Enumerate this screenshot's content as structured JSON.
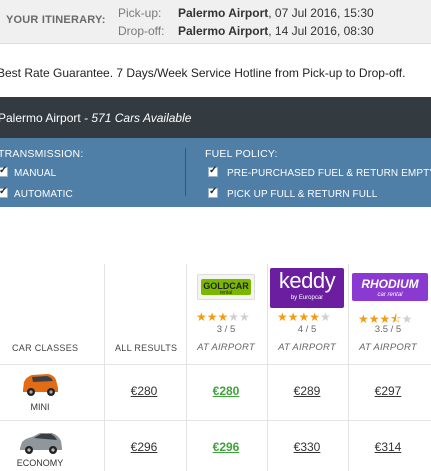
{
  "itinerary": {
    "label": "YOUR ITINERARY:",
    "pickup_label": "Pick-up:",
    "pickup_place": "Palermo Airport",
    "pickup_time": ", 07 Jul 2016, 15:30",
    "dropoff_label": "Drop-off:",
    "dropoff_place": "Palermo Airport",
    "dropoff_time": ", 14 Jul 2016, 08:30"
  },
  "guarantee_text": "Best Rate Guarantee. 7 Days/Week Service Hotline from Pick-up to Drop-off.",
  "location": {
    "name": "Palermo Airport",
    "availability": " - 571 Cars Available"
  },
  "filters": {
    "transmission_title": "TRANSMISSION:",
    "transmission_options": [
      "MANUAL",
      "AUTOMATIC"
    ],
    "fuel_title": "FUEL POLICY:",
    "fuel_options": [
      "PRE-PURCHASED FUEL & RETURN EMPTY",
      "PICK UP FULL & RETURN FULL"
    ]
  },
  "table": {
    "col_car_classes": "CAR CLASSES",
    "col_all_results": "ALL RESULTS",
    "suppliers": [
      {
        "name": "GOLDCAR",
        "sub": "rental",
        "rating": "3 / 5",
        "stars": 3,
        "location": "AT AIRPORT",
        "color": "#7ab800"
      },
      {
        "name": "keddy",
        "sub": "by Europcar",
        "rating": "4 / 5",
        "stars": 4,
        "location": "AT AIRPORT",
        "color": "#6b1fa0"
      },
      {
        "name": "RHODIUM",
        "sub": "car rental",
        "rating": "3.5 / 5",
        "stars": 3.5,
        "location": "AT AIRPORT",
        "color": "#8a3ad0"
      }
    ],
    "rows": [
      {
        "class": "MINI",
        "all": "€280",
        "prices": [
          "€280",
          "€289",
          "€297"
        ],
        "best_index": 0,
        "car_color": "#e36b12"
      },
      {
        "class": "ECONOMY",
        "all": "€296",
        "prices": [
          "€296",
          "€330",
          "€314"
        ],
        "best_index": 0,
        "car_color": "#8f969c"
      }
    ]
  },
  "colors": {
    "filter_bar": "#4f7ea6",
    "location_bar": "#333a40",
    "best_price": "#3fa23a",
    "star": "#f39c12"
  }
}
